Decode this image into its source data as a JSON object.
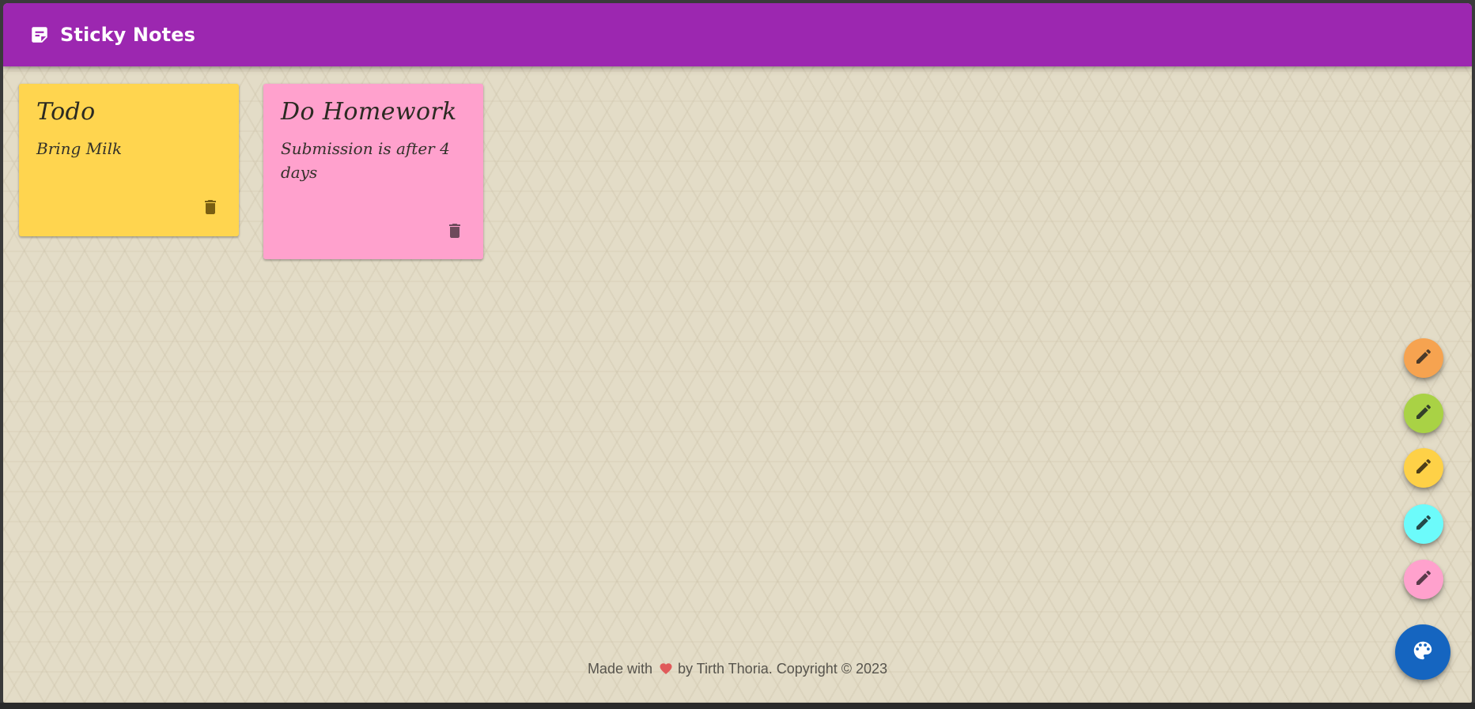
{
  "app": {
    "title": "Sticky Notes",
    "icon": "sticky-note-icon"
  },
  "notes": [
    {
      "title": "Todo",
      "body": "Bring Milk",
      "color": "#ffd54f",
      "delete_icon": "trash-icon"
    },
    {
      "title": "Do Homework",
      "body": "Submission is after 4 days",
      "color": "#ffa1cd",
      "delete_icon": "trash-icon"
    }
  ],
  "color_buttons": [
    {
      "color": "#f6a350",
      "icon": "pencil-icon"
    },
    {
      "color": "#a9d245",
      "icon": "pencil-icon"
    },
    {
      "color": "#fed147",
      "icon": "pencil-icon"
    },
    {
      "color": "#6cfbfb",
      "icon": "pencil-icon"
    },
    {
      "color": "#ffa1cd",
      "icon": "pencil-icon"
    }
  ],
  "palette_button": {
    "color": "#1565c0",
    "icon": "palette-icon"
  },
  "footer": {
    "prefix": "Made with",
    "heart_icon": "heart-icon",
    "suffix": "by Tirth Thoria. Copyright © 2023"
  }
}
